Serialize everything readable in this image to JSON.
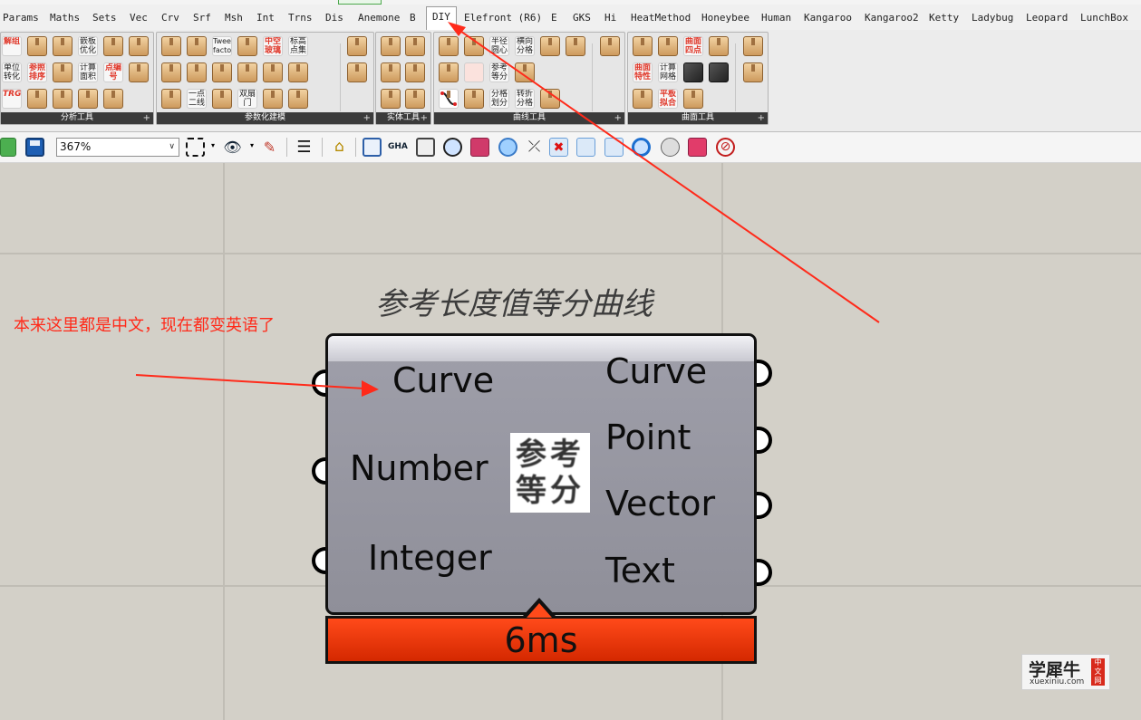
{
  "tabs": [
    "Params",
    "Maths",
    "Sets",
    "Vec",
    "Crv",
    "Srf",
    "Msh",
    "Int",
    "Trns",
    "Dis",
    "Anemone",
    "B",
    "DIY",
    "Elefront (R6)",
    "E",
    "GKS",
    "Hi",
    "HeatMethod",
    "Honeybee",
    "Human",
    "Kangaroo",
    "Kangaroo2",
    "Ketty",
    "Ladybug",
    "Leopard",
    "LunchBox"
  ],
  "active_tab": "DIY",
  "ribbon": {
    "panels": [
      {
        "label": "分析工具"
      },
      {
        "label": "参数化建模"
      },
      {
        "label": "实体工具"
      },
      {
        "label": "曲线工具"
      },
      {
        "label": "曲面工具"
      }
    ],
    "text_buttons": {
      "jiezu": "解组",
      "qianban": "嵌板优化",
      "danwei": "单位转化",
      "canzhao": "参照排序",
      "jisuan_mianji": "计算面积",
      "dianbianhao": "点编号",
      "trg": "TRG",
      "tween": "Tween factor",
      "zhongkong": "中空玻璃",
      "biaogao": "标高点集",
      "yidian": "一点二线",
      "shuangshan": "双扇门",
      "banjing": "半径圆心",
      "hengxiang": "横向分格",
      "canqi": "参考等分",
      "fenge": "分格划分",
      "zhuanzhe": "转折分格",
      "qumian_sidian": "曲面四点",
      "qumian_texing": "曲面特性",
      "jisuan_wangge": "计算网格",
      "pingban": "平板拟合"
    }
  },
  "toolbar": {
    "zoom_value": "367%"
  },
  "canvas": {
    "component_title": "参考长度值等分曲线",
    "annotation": "本来这里都是中文，现在都变英语了",
    "inputs": [
      "Curve",
      "Number",
      "Integer"
    ],
    "outputs": [
      "Curve",
      "Point",
      "Vector",
      "Text"
    ],
    "icon_text": "参考等分",
    "timer": "6ms"
  },
  "watermark": {
    "title": "学犀牛",
    "url": "xuexiniu.com",
    "seal": "中文网"
  },
  "colors": {
    "accent_red": "#ff2a1a",
    "timer_bg": "#e23400",
    "canvas_bg": "#d3d0c8"
  }
}
